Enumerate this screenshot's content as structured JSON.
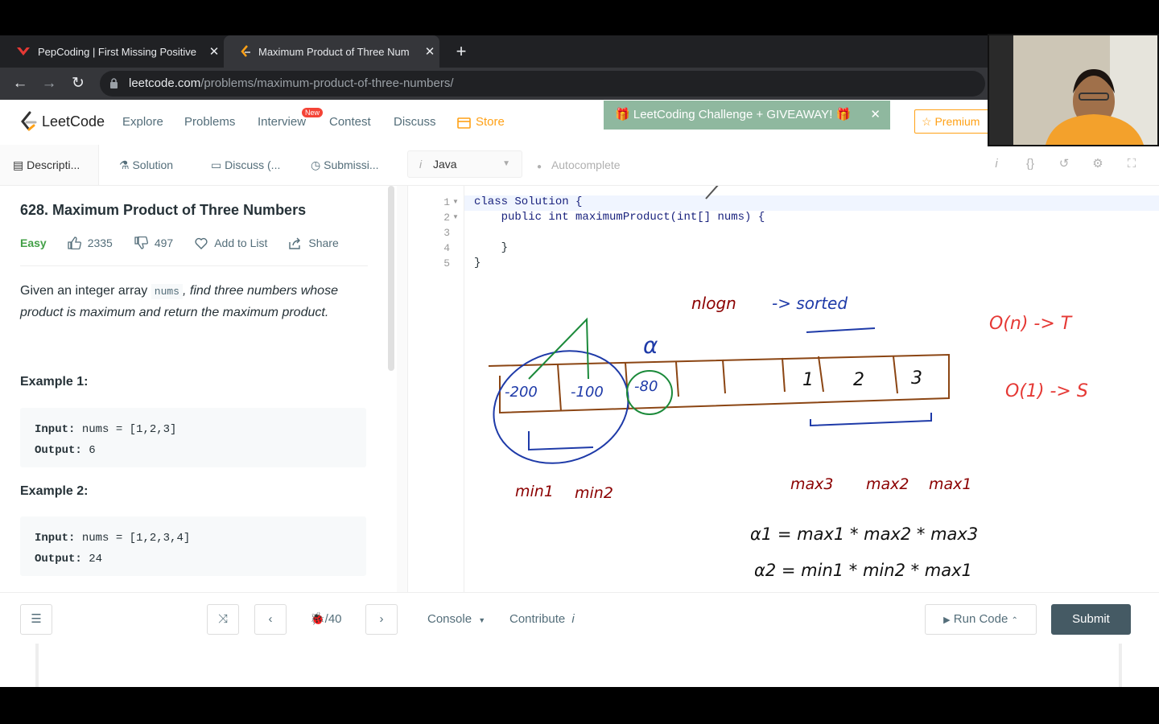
{
  "browser": {
    "tabs": [
      {
        "title": "PepCoding | First Missing Positive",
        "active": false
      },
      {
        "title": "Maximum Product of Three Num",
        "active": true
      }
    ],
    "url_host": "leetcode.com",
    "url_path": "/problems/maximum-product-of-three-numbers/"
  },
  "nav": {
    "logo": "LeetCode",
    "links": [
      "Explore",
      "Problems",
      "Interview",
      "Contest",
      "Discuss"
    ],
    "new_badge": "New",
    "store": "Store",
    "banner": "LeetCoding Challenge + GIVEAWAY!",
    "premium": "Premium"
  },
  "toolbar": {
    "tabs": [
      "Descripti...",
      "Solution",
      "Discuss (...",
      "Submissi..."
    ],
    "language": "Java",
    "autocomplete": "Autocomplete"
  },
  "problem": {
    "title": "628. Maximum Product of Three Numbers",
    "difficulty": "Easy",
    "likes": "2335",
    "dislikes": "497",
    "add_to_list": "Add to List",
    "share": "Share",
    "desc_prefix": "Given an integer array",
    "desc_code": "nums",
    "desc_suffix": ", find three numbers whose product is maximum and return the maximum product.",
    "examples": [
      {
        "heading": "Example 1:",
        "input_label": "Input:",
        "input": "nums = [1,2,3]",
        "output_label": "Output:",
        "output": "6"
      },
      {
        "heading": "Example 2:",
        "input_label": "Input:",
        "input": "nums = [1,2,3,4]",
        "output_label": "Output:",
        "output": "24"
      }
    ]
  },
  "code": {
    "lines": [
      {
        "n": "1",
        "text": "class Solution {"
      },
      {
        "n": "2",
        "text": "    public int maximumProduct(int[] nums) {"
      },
      {
        "n": "3",
        "text": ""
      },
      {
        "n": "4",
        "text": "    }"
      },
      {
        "n": "5",
        "text": "}"
      }
    ]
  },
  "annotations": {
    "nlogn": "nlogn",
    "sorted": "-> sorted",
    "time": "O(n) -> T",
    "space": "O(1) -> S",
    "alpha": "α",
    "cells": [
      "-200",
      "-100",
      "-80",
      "1",
      "2",
      "3"
    ],
    "min_labels": [
      "min1",
      "min2"
    ],
    "max_labels": [
      "max3",
      "max2",
      "max1"
    ],
    "eq1": "α1 = max1 * max2 * max3",
    "eq2": "α2 = min1 * min2 * max1"
  },
  "bottom": {
    "page": "🐞/40",
    "console": "Console",
    "contribute": "Contribute",
    "run": "Run Code",
    "submit": "Submit"
  },
  "colors": {
    "accent": "#ffa116",
    "easy": "#43a047",
    "submit_bg": "#455a64"
  }
}
